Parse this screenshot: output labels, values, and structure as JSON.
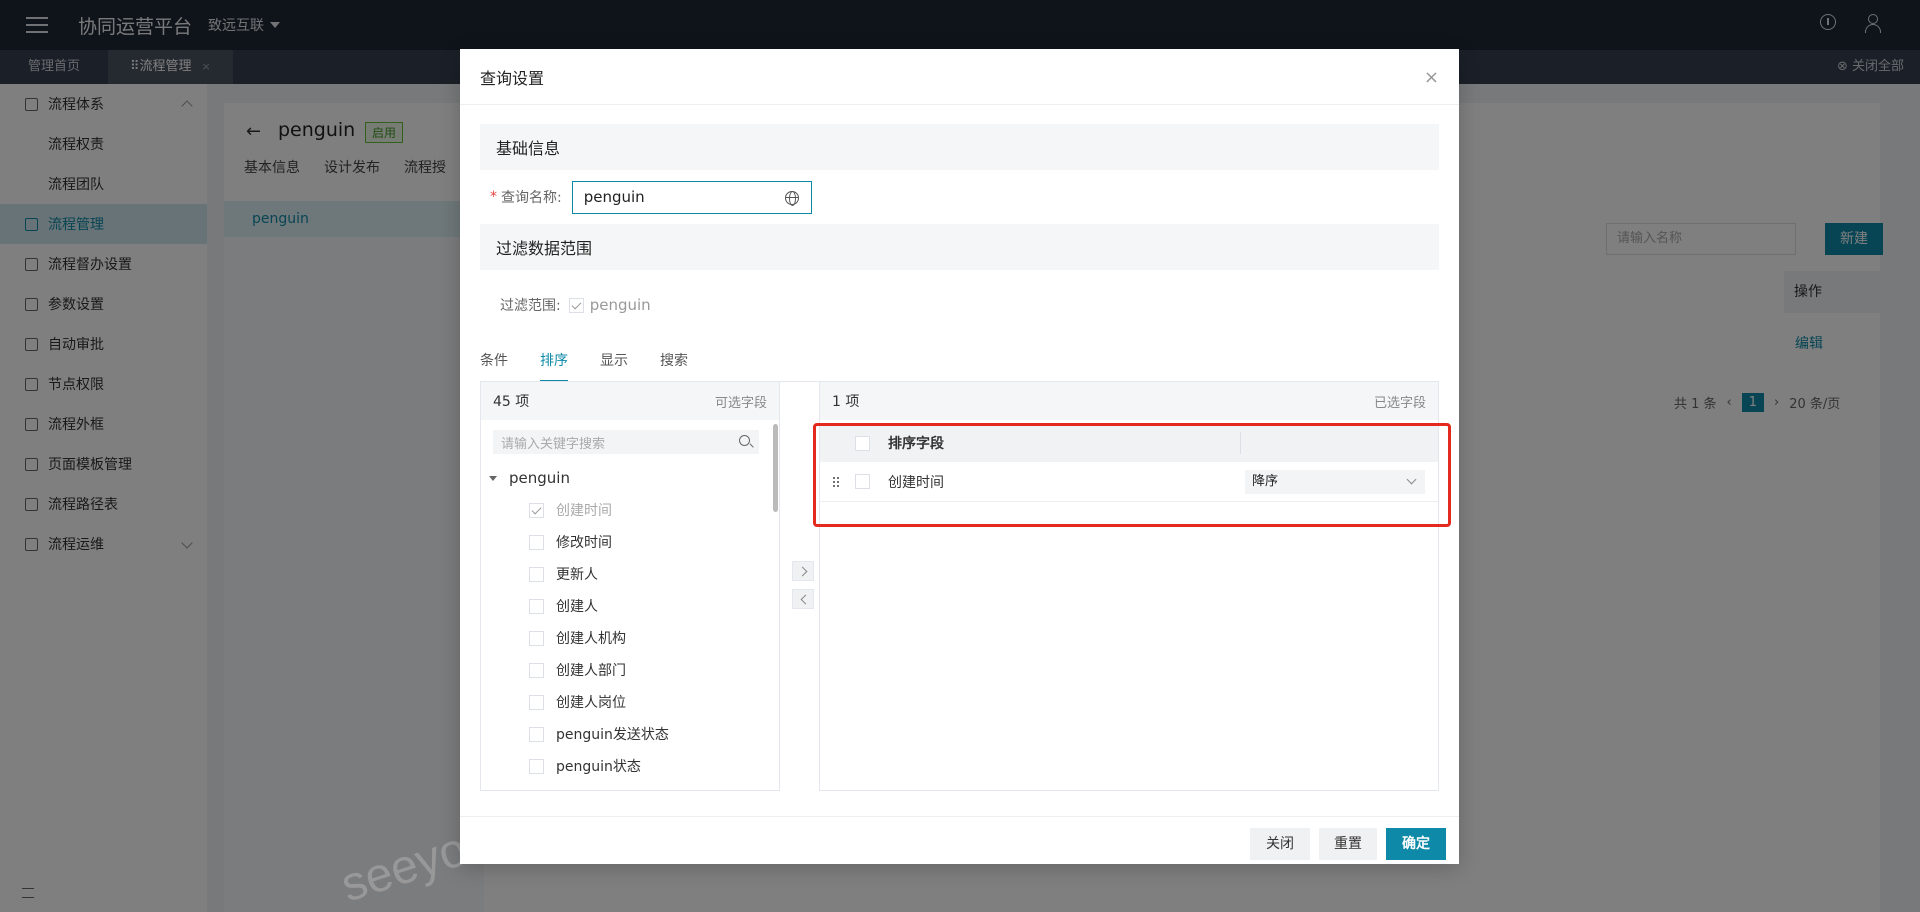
{
  "topbar": {
    "app_title": "协同运营平台",
    "org": "致远互联"
  },
  "tabbar": {
    "tabs": [
      "管理首页",
      "⠿流程管理"
    ],
    "close_all": "⊗ 关闭全部"
  },
  "sidebar": {
    "items": [
      {
        "label": "流程体系"
      },
      {
        "label": "流程权责"
      },
      {
        "label": "流程团队"
      },
      {
        "label": "流程管理"
      },
      {
        "label": "流程督办设置"
      },
      {
        "label": "参数设置"
      },
      {
        "label": "自动审批"
      },
      {
        "label": "节点权限"
      },
      {
        "label": "流程外框"
      },
      {
        "label": "页面模板管理"
      },
      {
        "label": "流程路径表"
      },
      {
        "label": "流程运维"
      }
    ]
  },
  "page": {
    "back": "←",
    "title": "penguin",
    "status": "启用",
    "subtabs": [
      "基本信息",
      "设计发布",
      "流程授"
    ],
    "left_selected": "penguin",
    "search_placeholder": "请输入名称",
    "new_button": "新建",
    "col_op": "操作",
    "edit": "编辑",
    "pager": {
      "total": "共 1 条",
      "page": "1",
      "size": "20 条/页"
    }
  },
  "dialog": {
    "title": "查询设置",
    "close": "×",
    "section_basic": "基础信息",
    "name_label": "查询名称:",
    "name_required": "*",
    "name_value": "penguin",
    "section_filter": "过滤数据范围",
    "filter_label": "过滤范围:",
    "filter_value": "penguin",
    "tabs": [
      "条件",
      "排序",
      "显示",
      "搜索"
    ],
    "active_tab": "排序",
    "left_panel": {
      "count": "45 项",
      "title": "可选字段",
      "search_placeholder": "请输入关键字搜索",
      "root": "penguin",
      "items": [
        {
          "label": "创建时间",
          "checked": true,
          "disabled": true
        },
        {
          "label": "修改时间",
          "checked": false
        },
        {
          "label": "更新人",
          "checked": false
        },
        {
          "label": "创建人",
          "checked": false
        },
        {
          "label": "创建人机构",
          "checked": false
        },
        {
          "label": "创建人部门",
          "checked": false
        },
        {
          "label": "创建人岗位",
          "checked": false
        },
        {
          "label": "penguin发送状态",
          "checked": false
        },
        {
          "label": "penguin状态",
          "checked": false
        }
      ]
    },
    "right_panel": {
      "count": "1 项",
      "title": "已选字段",
      "col_field": "排序字段",
      "rows": [
        {
          "field": "创建时间",
          "order": "降序"
        }
      ]
    },
    "footer": {
      "close": "关闭",
      "reset": "重置",
      "ok": "确定"
    }
  },
  "watermark": "seeyo",
  "colors": {
    "accent": "#0e8aa8",
    "highlight": "#e42a1f",
    "topbar": "#1f2937"
  }
}
